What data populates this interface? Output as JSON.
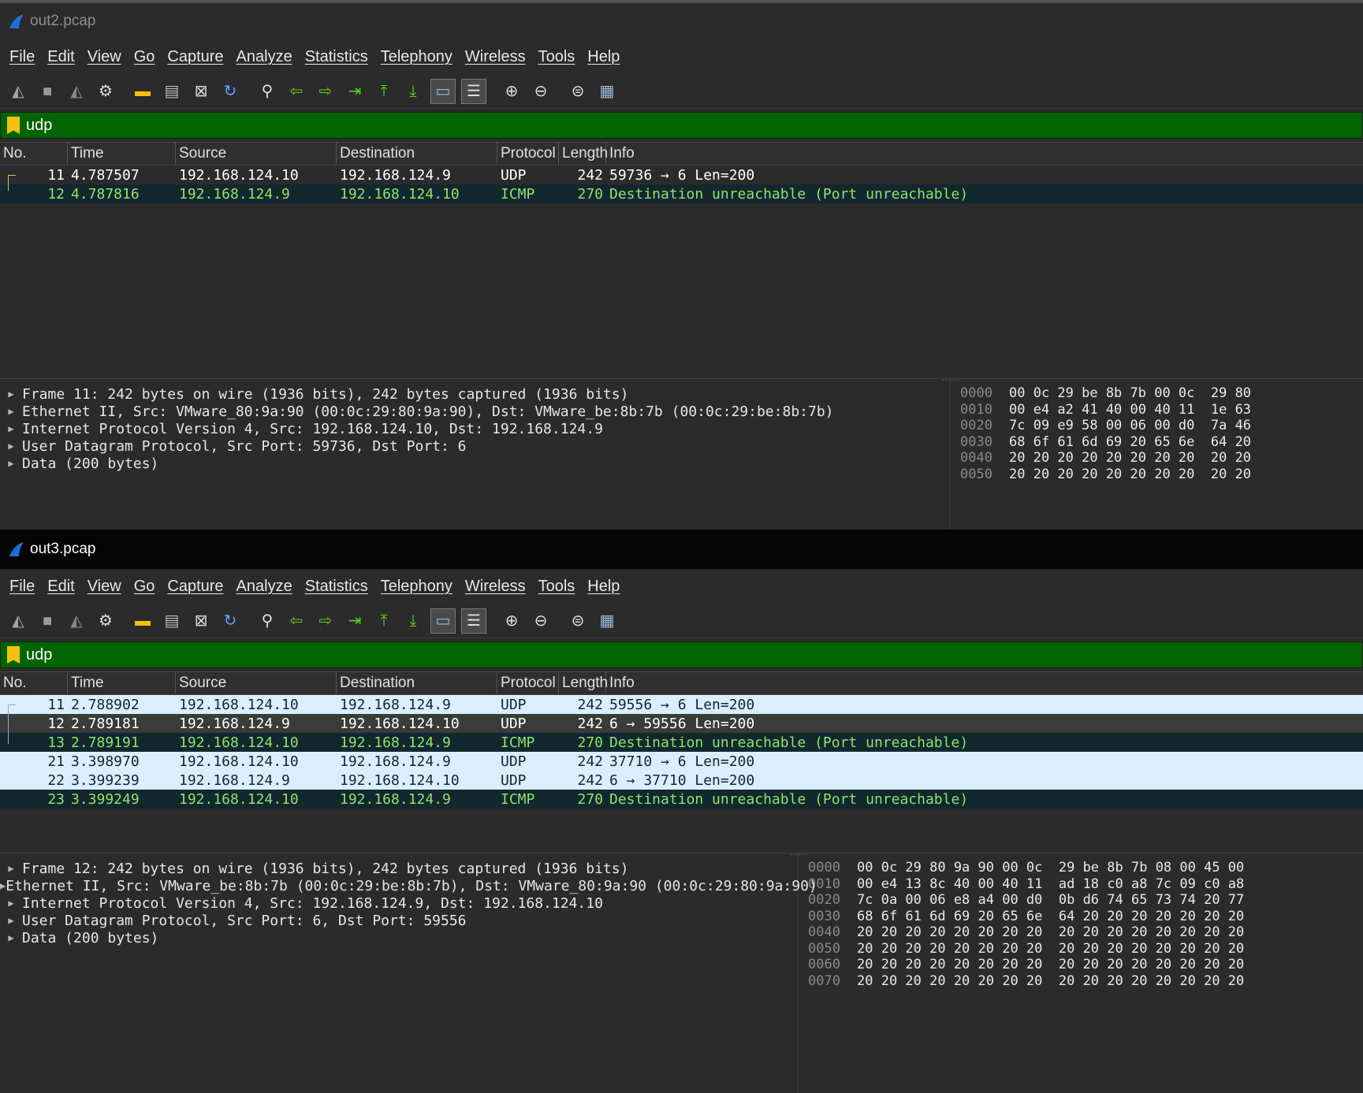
{
  "windows": [
    {
      "title": "out2.pcap",
      "menu": [
        "File",
        "Edit",
        "View",
        "Go",
        "Capture",
        "Analyze",
        "Statistics",
        "Telephony",
        "Wireless",
        "Tools",
        "Help"
      ],
      "filter": "udp",
      "columns": [
        "No.",
        "Time",
        "Source",
        "Destination",
        "Protocol",
        "Length",
        "Info"
      ],
      "packets": [
        {
          "no": "11",
          "time": "4.787507",
          "src": "192.168.124.10",
          "dst": "192.168.124.9",
          "proto": "UDP",
          "len": "242",
          "info": "59736 → 6 Len=200",
          "style": "udp-dark"
        },
        {
          "no": "12",
          "time": "4.787816",
          "src": "192.168.124.9",
          "dst": "192.168.124.10",
          "proto": "ICMP",
          "len": "270",
          "info": "Destination unreachable (Port unreachable)",
          "style": "icmp"
        }
      ],
      "tree": [
        "Frame 11: 242 bytes on wire (1936 bits), 242 bytes captured (1936 bits)",
        "Ethernet II, Src: VMware_80:9a:90 (00:0c:29:80:9a:90), Dst: VMware_be:8b:7b (00:0c:29:be:8b:7b)",
        "Internet Protocol Version 4, Src: 192.168.124.10, Dst: 192.168.124.9",
        "User Datagram Protocol, Src Port: 59736, Dst Port: 6",
        "Data (200 bytes)"
      ],
      "hex": [
        {
          "off": "0000",
          "bytes": "00 0c 29 be 8b 7b 00 0c  29 80"
        },
        {
          "off": "0010",
          "bytes": "00 e4 a2 41 40 00 40 11  1e 63"
        },
        {
          "off": "0020",
          "bytes": "7c 09 e9 58 00 06 00 d0  7a 46"
        },
        {
          "off": "0030",
          "bytes": "68 6f 61 6d 69 20 65 6e  64 20"
        },
        {
          "off": "0040",
          "bytes": "20 20 20 20 20 20 20 20  20 20"
        },
        {
          "off": "0050",
          "bytes": "20 20 20 20 20 20 20 20  20 20"
        }
      ]
    },
    {
      "title": "out3.pcap",
      "menu": [
        "File",
        "Edit",
        "View",
        "Go",
        "Capture",
        "Analyze",
        "Statistics",
        "Telephony",
        "Wireless",
        "Tools",
        "Help"
      ],
      "filter": "udp",
      "columns": [
        "No.",
        "Time",
        "Source",
        "Destination",
        "Protocol",
        "Length",
        "Info"
      ],
      "packets": [
        {
          "no": "11",
          "time": "2.788902",
          "src": "192.168.124.10",
          "dst": "192.168.124.9",
          "proto": "UDP",
          "len": "242",
          "info": "59556 → 6 Len=200",
          "style": "udp-light"
        },
        {
          "no": "12",
          "time": "2.789181",
          "src": "192.168.124.9",
          "dst": "192.168.124.10",
          "proto": "UDP",
          "len": "242",
          "info": "6 → 59556 Len=200",
          "style": "udp-sel"
        },
        {
          "no": "13",
          "time": "2.789191",
          "src": "192.168.124.10",
          "dst": "192.168.124.9",
          "proto": "ICMP",
          "len": "270",
          "info": "Destination unreachable (Port unreachable)",
          "style": "icmp"
        },
        {
          "no": "21",
          "time": "3.398970",
          "src": "192.168.124.10",
          "dst": "192.168.124.9",
          "proto": "UDP",
          "len": "242",
          "info": "37710 → 6 Len=200",
          "style": "udp-light"
        },
        {
          "no": "22",
          "time": "3.399239",
          "src": "192.168.124.9",
          "dst": "192.168.124.10",
          "proto": "UDP",
          "len": "242",
          "info": "6 → 37710 Len=200",
          "style": "udp-light"
        },
        {
          "no": "23",
          "time": "3.399249",
          "src": "192.168.124.10",
          "dst": "192.168.124.9",
          "proto": "ICMP",
          "len": "270",
          "info": "Destination unreachable (Port unreachable)",
          "style": "icmp"
        }
      ],
      "tree": [
        "Frame 12: 242 bytes on wire (1936 bits), 242 bytes captured (1936 bits)",
        "Ethernet II, Src: VMware_be:8b:7b (00:0c:29:be:8b:7b), Dst: VMware_80:9a:90 (00:0c:29:80:9a:90)",
        "Internet Protocol Version 4, Src: 192.168.124.9, Dst: 192.168.124.10",
        "User Datagram Protocol, Src Port: 6, Dst Port: 59556",
        "Data (200 bytes)"
      ],
      "hex": [
        {
          "off": "0000",
          "bytes": "00 0c 29 80 9a 90 00 0c  29 be 8b 7b 08 00 45 00"
        },
        {
          "off": "0010",
          "bytes": "00 e4 13 8c 40 00 40 11  ad 18 c0 a8 7c 09 c0 a8"
        },
        {
          "off": "0020",
          "bytes": "7c 0a 00 06 e8 a4 00 d0  0b d6 74 65 73 74 20 77"
        },
        {
          "off": "0030",
          "bytes": "68 6f 61 6d 69 20 65 6e  64 20 20 20 20 20 20 20"
        },
        {
          "off": "0040",
          "bytes": "20 20 20 20 20 20 20 20  20 20 20 20 20 20 20 20"
        },
        {
          "off": "0050",
          "bytes": "20 20 20 20 20 20 20 20  20 20 20 20 20 20 20 20"
        },
        {
          "off": "0060",
          "bytes": "20 20 20 20 20 20 20 20  20 20 20 20 20 20 20 20"
        },
        {
          "off": "0070",
          "bytes": "20 20 20 20 20 20 20 20  20 20 20 20 20 20 20 20"
        }
      ]
    }
  ],
  "toolbar_icons": [
    "start-capture-icon",
    "stop-capture-icon",
    "restart-capture-icon",
    "capture-options-icon",
    "open-file-icon",
    "save-file-icon",
    "close-file-icon",
    "reload-file-icon",
    "find-packet-icon",
    "go-back-icon",
    "go-forward-icon",
    "go-to-packet-icon",
    "first-packet-icon",
    "last-packet-icon",
    "auto-scroll-icon",
    "colorize-icon",
    "zoom-in-icon",
    "zoom-out-icon",
    "normal-size-icon",
    "resize-columns-icon"
  ],
  "colors": {
    "filter_bg": "#006400",
    "icmp_fg": "#8de46a",
    "icmp_bg": "#12272e",
    "udp_light_bg": "#daeeff"
  }
}
